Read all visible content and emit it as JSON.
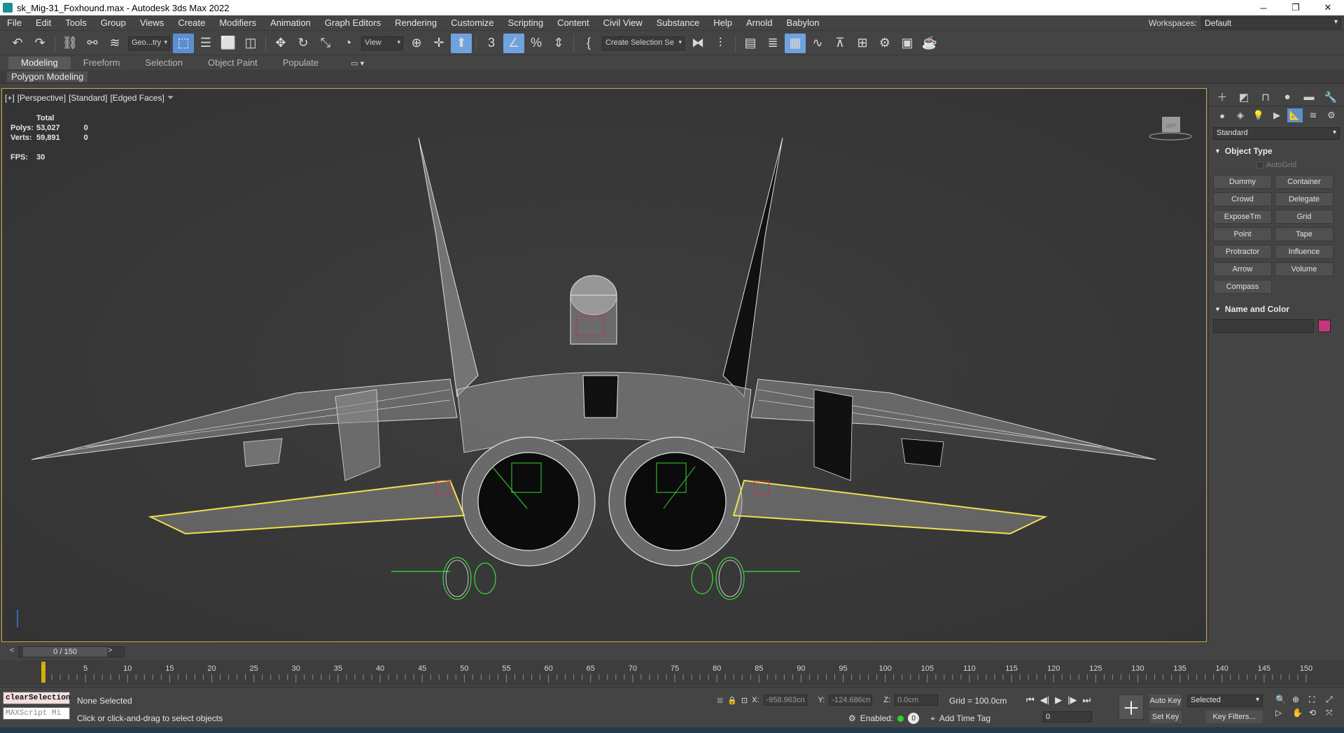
{
  "window": {
    "title": "sk_Mig-31_Foxhound.max - Autodesk 3ds Max 2022",
    "minimize": "─",
    "maximize": "❐",
    "close": "✕"
  },
  "menu": [
    "File",
    "Edit",
    "Tools",
    "Group",
    "Views",
    "Create",
    "Modifiers",
    "Animation",
    "Graph Editors",
    "Rendering",
    "Customize",
    "Scripting",
    "Content",
    "Civil View",
    "Substance",
    "Help",
    "Arnold",
    "Babylon"
  ],
  "workspace": {
    "label": "Workspaces:",
    "value": "Default"
  },
  "toolbar": {
    "selection_filter": "Geo...try",
    "ref_coord": "View",
    "named_selection": "Create Selection Se"
  },
  "ribbon": {
    "tabs": [
      "Modeling",
      "Freeform",
      "Selection",
      "Object Paint",
      "Populate"
    ],
    "active_tab": "Modeling",
    "sub_label": "Polygon Modeling"
  },
  "viewport": {
    "label_plus": "[+]",
    "label_view": "[Perspective]",
    "label_shading": "[Standard]",
    "label_edges": "[Edged Faces]",
    "stats": {
      "total_header": "Total",
      "polys_label": "Polys:",
      "polys_total": "53,027",
      "polys_sel": "0",
      "verts_label": "Verts:",
      "verts_total": "59,891",
      "verts_sel": "0",
      "fps_label": "FPS:",
      "fps": "30"
    },
    "viewcube_label": "LEFT",
    "axis_label": "z"
  },
  "command_panel": {
    "category": "Standard",
    "object_type_title": "Object Type",
    "autogrid": "AutoGrid",
    "buttons": [
      "Dummy",
      "Container",
      "Crowd",
      "Delegate",
      "ExposeTm",
      "Grid",
      "Point",
      "Tape",
      "Protractor",
      "Influence",
      "Arrow",
      "Volume",
      "Compass"
    ],
    "name_color_title": "Name and Color",
    "swatch_color": "#c2387d"
  },
  "timeline": {
    "frame_display": "0 / 150",
    "ticks": [
      "0",
      "5",
      "10",
      "15",
      "20",
      "25",
      "30",
      "35",
      "40",
      "45",
      "50",
      "55",
      "60",
      "65",
      "70",
      "75",
      "80",
      "85",
      "90",
      "95",
      "100",
      "105",
      "110",
      "115",
      "120",
      "125",
      "130",
      "135",
      "140",
      "145",
      "150"
    ]
  },
  "status": {
    "maxscript_cmd": "clearSelection",
    "maxscript_placeholder": "MAXScript Mi",
    "selection": "None Selected",
    "prompt": "Click or click-and-drag to select objects",
    "x_label": "X:",
    "x_value": "-958.963cn",
    "y_label": "Y:",
    "y_value": "-124.686cn",
    "z_label": "Z:",
    "z_value": "0.0cm",
    "grid": "Grid = 100.0cm",
    "enabled": "Enabled:",
    "enabled_badge": "0",
    "add_time_tag": "Add Time Tag",
    "frame": "0",
    "auto_key": "Auto Key",
    "set_key": "Set Key",
    "selected_dd": "Selected",
    "key_filters": "Key Filters..."
  }
}
